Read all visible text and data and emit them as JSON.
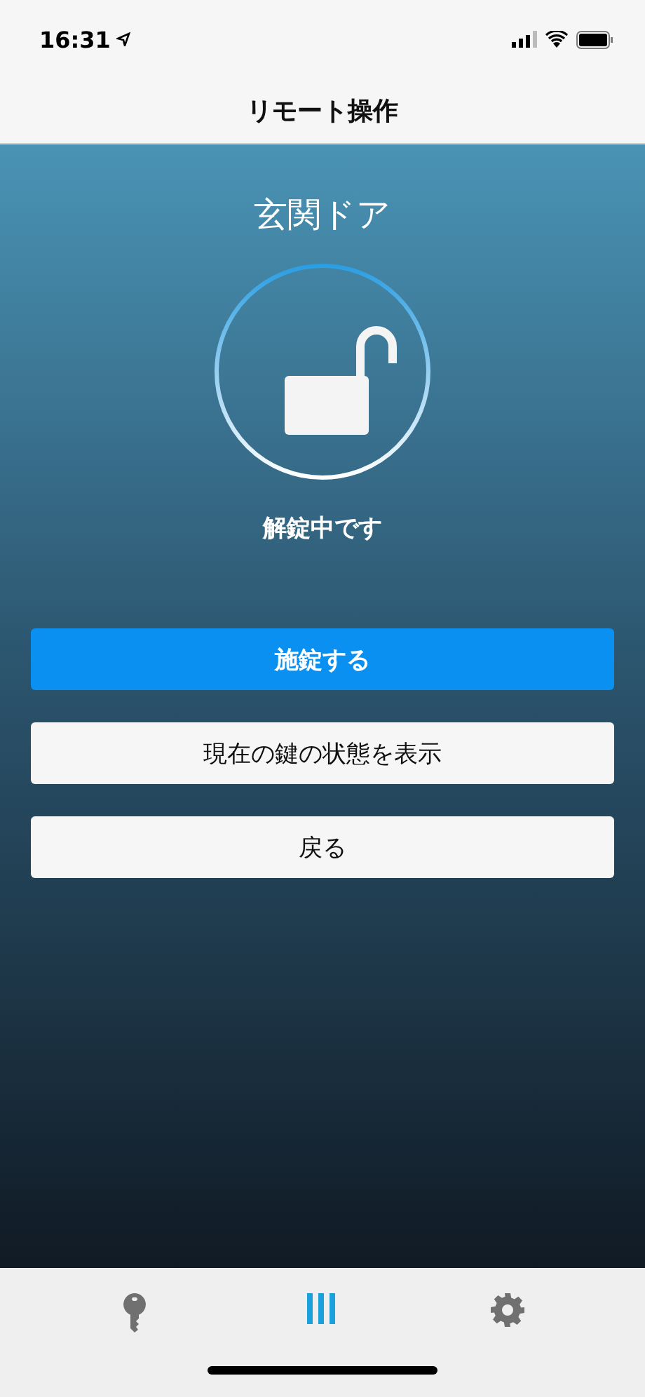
{
  "status_bar": {
    "time": "16:31"
  },
  "nav_bar": {
    "title": "リモート操作"
  },
  "lock": {
    "name": "玄関ドア",
    "locked": false,
    "status": "解錠中です"
  },
  "buttons": [
    {
      "label": "施錠する",
      "kind": "primary"
    },
    {
      "label": "現在の鍵の状態を表示",
      "kind": "secondary"
    },
    {
      "label": "戻る",
      "kind": "secondary"
    }
  ],
  "tab_bar": [
    {
      "kind": "key",
      "selected": false
    },
    {
      "kind": "remote",
      "selected": true
    },
    {
      "kind": "settings",
      "selected": false
    }
  ]
}
